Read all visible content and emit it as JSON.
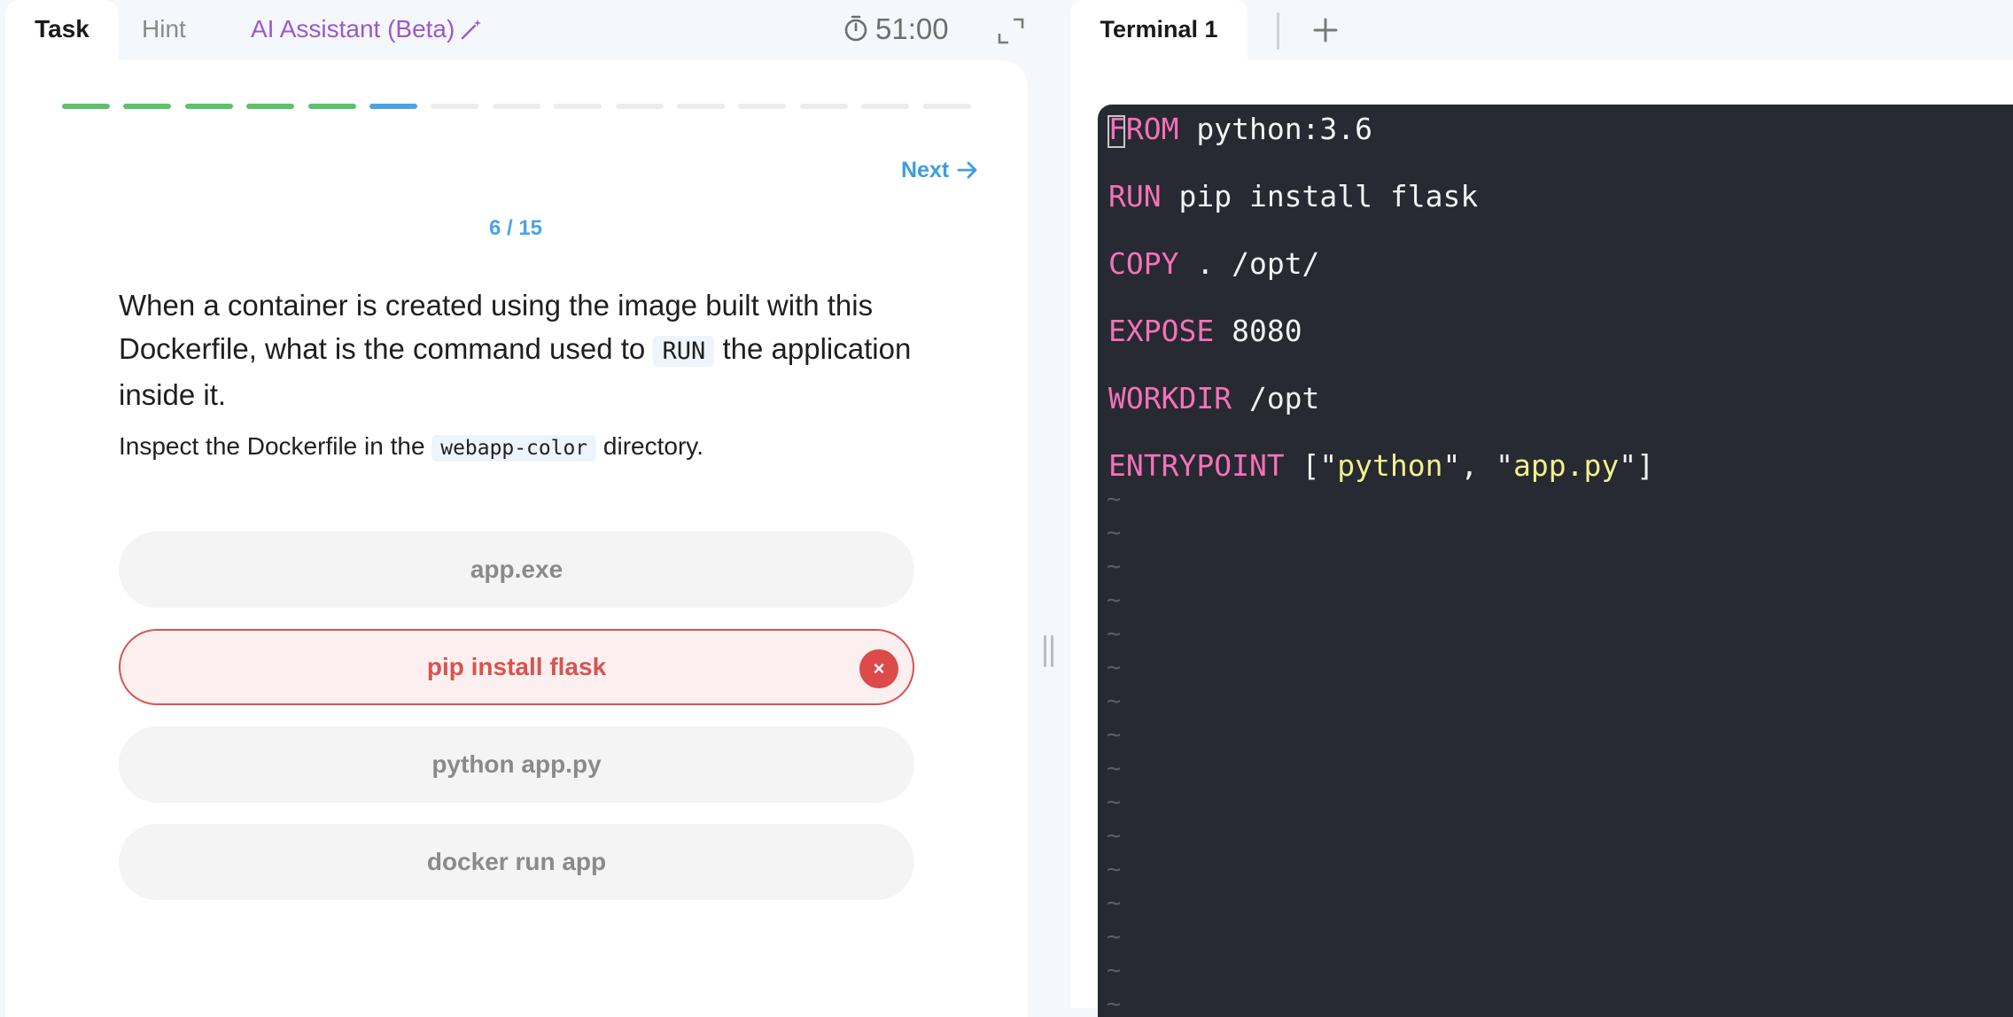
{
  "tabs": {
    "task": "Task",
    "hint": "Hint",
    "ai_assistant": "AI Assistant (Beta)"
  },
  "timer": "51:00",
  "progress": {
    "total": 15,
    "completed": 5,
    "current": 6
  },
  "next_label": "Next",
  "counter": "6 / 15",
  "question": {
    "before": "When a container is created using the image built with this Dockerfile, what is the command used to ",
    "code": "RUN",
    "after": " the application inside it."
  },
  "instruction": {
    "before": "Inspect the Dockerfile in the ",
    "code": "webapp-color",
    "after": " directory."
  },
  "options": [
    {
      "label": "app.exe",
      "state": "neutral"
    },
    {
      "label": "pip install flask",
      "state": "wrong"
    },
    {
      "label": "python app.py",
      "state": "neutral"
    },
    {
      "label": "docker run app",
      "state": "neutral"
    }
  ],
  "wrong_icon": "×",
  "terminal": {
    "tab_label": "Terminal 1",
    "lines": [
      {
        "kw": "FROM",
        "rest": " python:3.6"
      },
      {
        "kw": "RUN",
        "rest": " pip install flask"
      },
      {
        "kw": "COPY",
        "rest": " . /opt/"
      },
      {
        "kw": "EXPOSE",
        "rest": " 8080"
      },
      {
        "kw": "WORKDIR",
        "rest": " /opt"
      },
      {
        "kw": "ENTRYPOINT",
        "rest": " [\"",
        "str1": "python",
        "mid": "\", \"",
        "str2": "app.py",
        "end": "\"]"
      }
    ],
    "empty_marker": "~"
  },
  "colors": {
    "done": "#5cc26b",
    "current": "#4aa3e8",
    "wrong": "#d9534f",
    "terminal_bg": "#272933",
    "keyword": "#f472b6",
    "string": "#f2f08a"
  },
  "icons": [
    "timer-icon",
    "expand-icon",
    "magic-wand-icon",
    "arrow-right-icon",
    "close-icon",
    "plus-icon"
  ]
}
